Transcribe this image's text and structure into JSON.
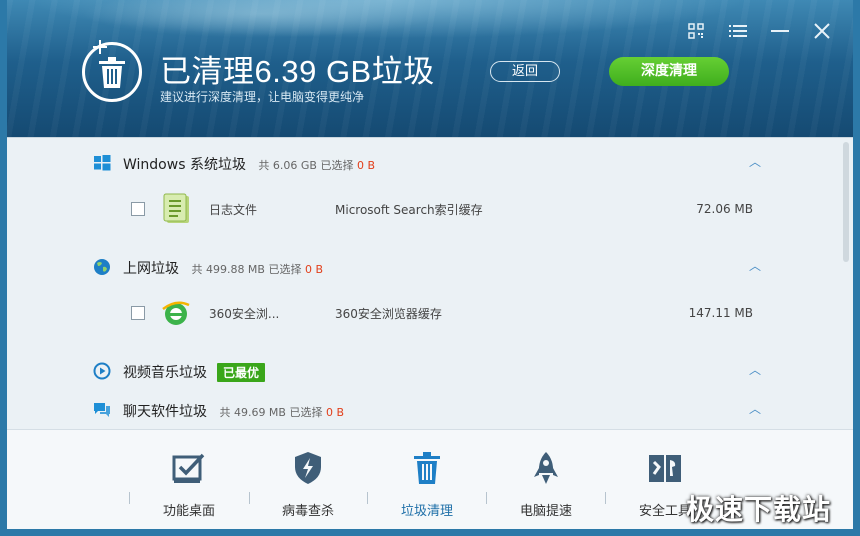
{
  "header": {
    "title": "已清理6.39 GB垃圾",
    "subtitle": "建议进行深度清理，让电脑变得更纯净",
    "back_label": "返回",
    "deep_clean_label": "深度清理"
  },
  "categories": [
    {
      "name": "Windows 系统垃圾",
      "meta_prefix": "共 6.06 GB 已选择",
      "meta_selected": "0 B",
      "icon": "windows-icon"
    },
    {
      "name": "上网垃圾",
      "meta_prefix": "共 499.88 MB 已选择",
      "meta_selected": "0 B",
      "icon": "globe-icon"
    },
    {
      "name": "视频音乐垃圾",
      "badge": "已最优",
      "icon": "play-icon"
    },
    {
      "name": "聊天软件垃圾",
      "meta_prefix": "共 49.69 MB 已选择",
      "meta_selected": "0 B",
      "icon": "chat-icon"
    }
  ],
  "items": [
    {
      "name": "日志文件",
      "desc": "Microsoft Search索引缓存",
      "size": "72.06 MB",
      "icon": "log-file-icon"
    },
    {
      "name": "360安全浏...",
      "desc": "360安全浏览器缓存",
      "size": "147.11 MB",
      "icon": "ie-browser-icon"
    }
  ],
  "toolbar": [
    {
      "label": "功能桌面",
      "icon": "desktop-check-icon"
    },
    {
      "label": "病毒查杀",
      "icon": "shield-bolt-icon"
    },
    {
      "label": "垃圾清理",
      "icon": "trash-icon",
      "active": true
    },
    {
      "label": "电脑提速",
      "icon": "rocket-icon"
    },
    {
      "label": "安全工具",
      "icon": "toolbox-icon"
    }
  ],
  "watermark": "极速下载站",
  "colors": {
    "accent_green": "#3fae1d",
    "selected_red": "#e2401c",
    "active_blue": "#1e6fa8"
  }
}
